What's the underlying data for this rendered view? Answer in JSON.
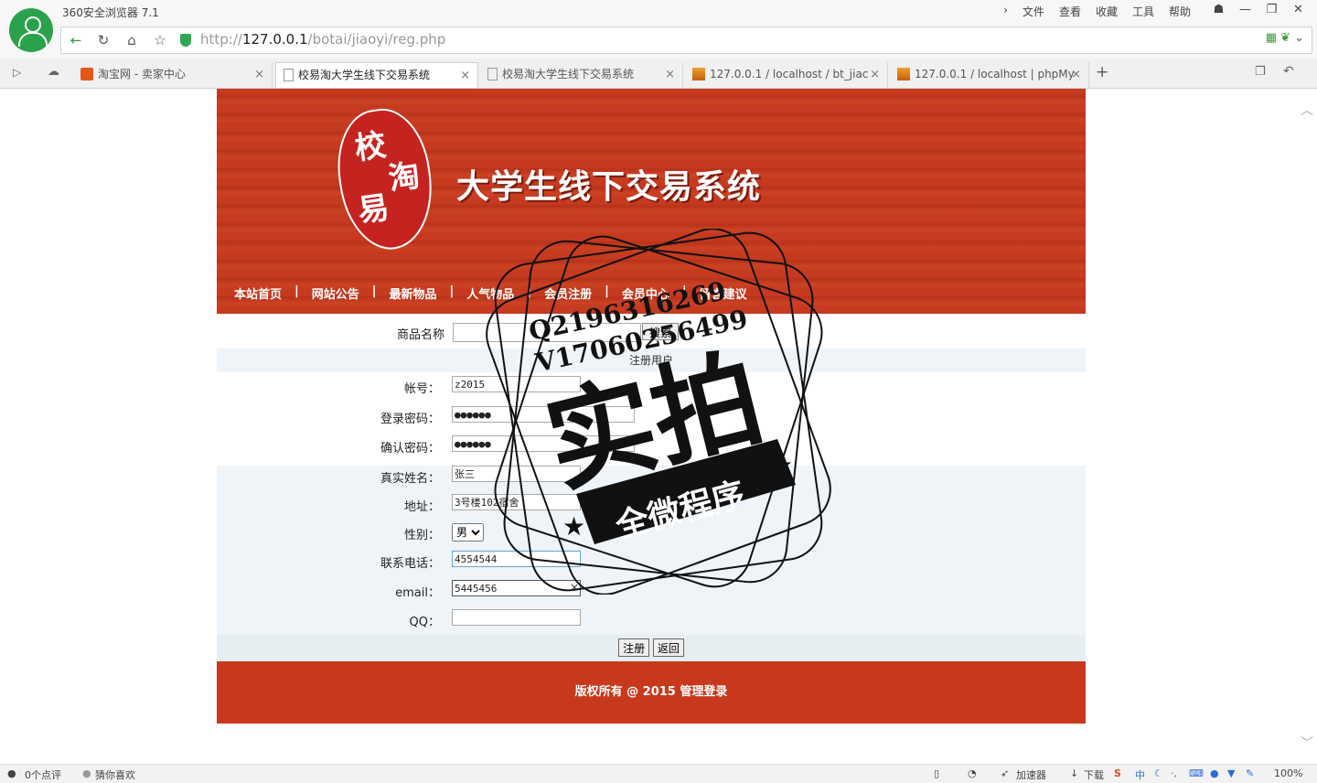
{
  "browser": {
    "title": "360安全浏览器 7.1",
    "menu": [
      "文件",
      "查看",
      "收藏",
      "工具",
      "帮助"
    ],
    "url_scheme": "http://",
    "url_host": "127.0.0.1",
    "url_path": "/botai/jiaoyi/reg.php",
    "tabs": [
      {
        "label": "淘宝网 - 卖家中心",
        "active": false
      },
      {
        "label": "校易淘大学生线下交易系统",
        "active": true
      },
      {
        "label": "校易淘大学生线下交易系统",
        "active": false
      },
      {
        "label": "127.0.0.1 / localhost / bt_jiac",
        "active": false
      },
      {
        "label": "127.0.0.1 / localhost | phpMy",
        "active": false
      }
    ]
  },
  "site": {
    "seal_chars": [
      "校",
      "淘",
      "易"
    ],
    "title": "大学生线下交易系统",
    "nav": [
      "本站首页",
      "网站公告",
      "最新物品",
      "人气物品",
      "会员注册",
      "会员中心",
      "留言建议"
    ],
    "nav_sep": "|",
    "search_label": "商品名称",
    "search_button": "搜索",
    "reg_title": "注册用户",
    "fields": [
      {
        "label": "帐号：",
        "value": "z2015"
      },
      {
        "label": "登录密码：",
        "value": "●●●●●●"
      },
      {
        "label": "确认密码：",
        "value": "●●●●●●"
      },
      {
        "label": "真实姓名：",
        "value": "张三"
      },
      {
        "label": "地址：",
        "value": "3号楼102宿舍"
      },
      {
        "label": "性别：",
        "value": "男"
      },
      {
        "label": "联系电话：",
        "value": "4554544"
      },
      {
        "label": "email：",
        "value": "5445456"
      },
      {
        "label": "QQ：",
        "value": ""
      }
    ],
    "submit": "注册",
    "back": "返回",
    "footer": "版权所有 @ 2015 管理登录"
  },
  "stamp": {
    "line1": "Q2196316269",
    "line2": "V17060256499",
    "main": "实拍",
    "ribbon": "全微程序"
  },
  "statusbar": {
    "comments": "0个点评",
    "guess": "猜你喜欢",
    "accelerator": "加速器",
    "download": "下载",
    "ime": "中",
    "zoom": "100%"
  },
  "colors": {
    "banner": "#c83a1f",
    "accent_green": "#2aa24b",
    "form_band": "#eef4f8"
  }
}
